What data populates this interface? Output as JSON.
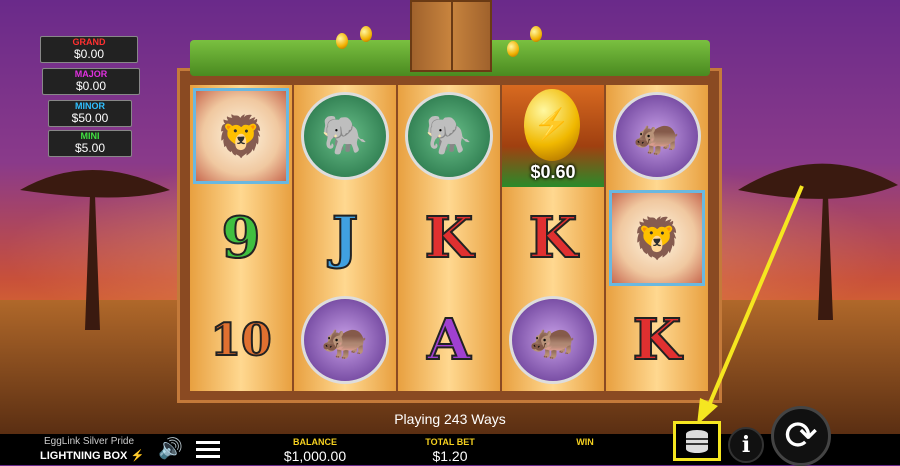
{
  "jackpots": [
    {
      "label": "GRAND",
      "value": "$0.00",
      "color": "#ff3030"
    },
    {
      "label": "MAJOR",
      "value": "$0.00",
      "color": "#e030e0"
    },
    {
      "label": "MINOR",
      "value": "$50.00",
      "color": "#30c0ff"
    },
    {
      "label": "MINI",
      "value": "$5.00",
      "color": "#40e040"
    }
  ],
  "golden_egg_amount": "$0.60",
  "ways_text": "Playing 243 Ways",
  "footer": {
    "game_name": "EggLink Silver Pride",
    "brand": "LIGHTNING BOX",
    "balance_label": "BALANCE",
    "balance_value": "$1,000.00",
    "total_bet_label": "TOTAL BET",
    "total_bet_value": "$1.20",
    "win_label": "WIN",
    "win_value": "",
    "info_icon": "i"
  },
  "reel_symbols": [
    [
      "lion",
      "9",
      "10"
    ],
    [
      "elephant",
      "J",
      "hippo"
    ],
    [
      "elephant",
      "K",
      "A"
    ],
    [
      "golden-egg",
      "K",
      "hippo"
    ],
    [
      "hippo",
      "lion",
      "K"
    ]
  ],
  "colors": {
    "highlight": "#f5e620",
    "accent": "#f5d020"
  }
}
